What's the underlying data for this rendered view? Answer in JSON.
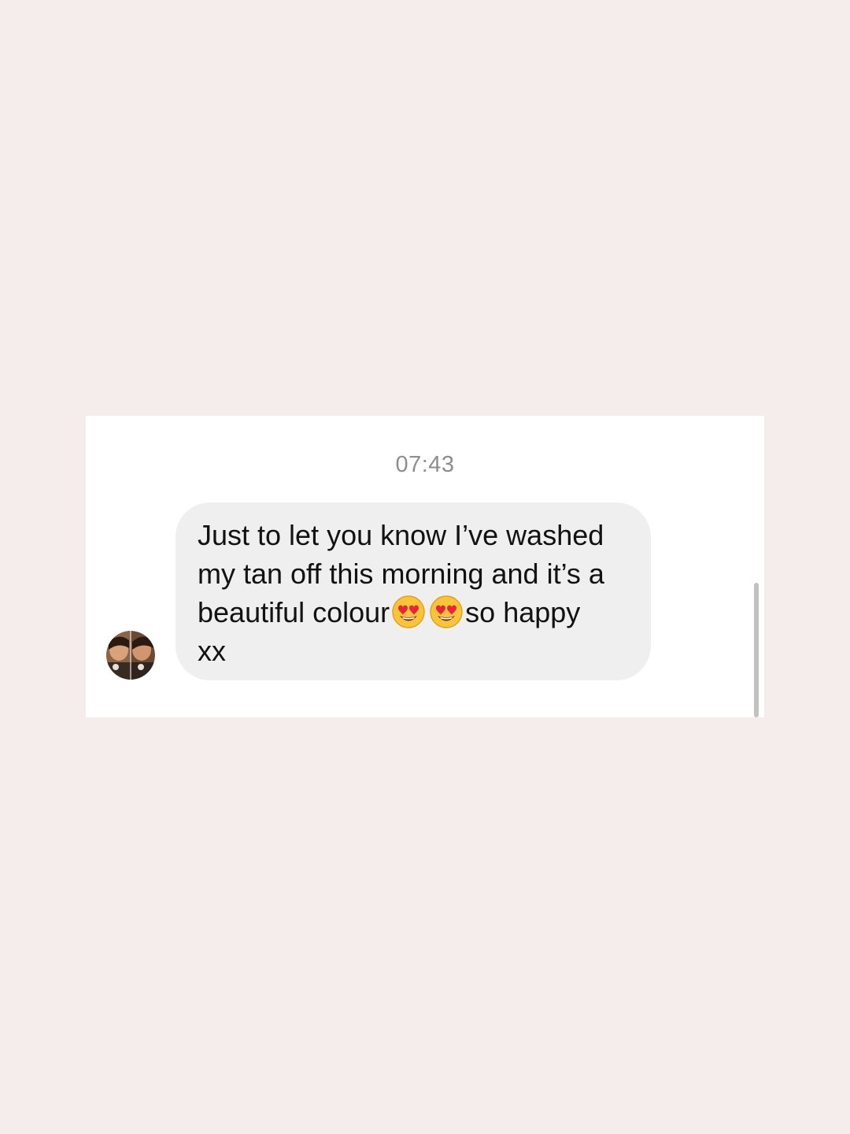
{
  "conversation": {
    "timestamp": "07:43",
    "message": {
      "line1": "Just to let you know I’ve washed",
      "line2": "my tan off this morning and it’s a",
      "line3_before": "beautiful colour",
      "line3_after": "so happy",
      "line4": "xx",
      "emoji_icons": [
        "smiling-face-with-heart-eyes-icon",
        "smiling-face-with-heart-eyes-icon"
      ]
    }
  },
  "colors": {
    "page_background": "#f5ecec",
    "card_background": "#ffffff",
    "bubble_background": "#efefef",
    "timestamp_text": "#8e8e8e",
    "message_text": "#121212"
  }
}
